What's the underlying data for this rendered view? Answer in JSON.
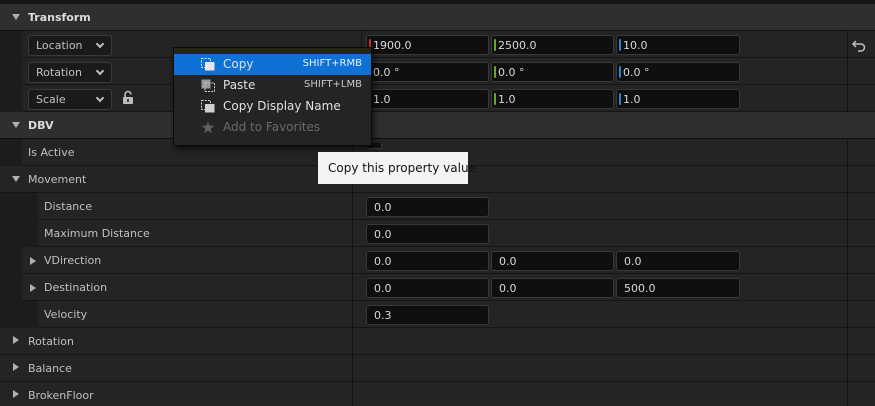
{
  "transform": {
    "title": "Transform",
    "rows": [
      {
        "mode": "Location",
        "values": [
          "1900.0",
          "2500.0",
          "10.0"
        ]
      },
      {
        "mode": "Rotation",
        "values": [
          "0.0 °",
          "0.0 °",
          "0.0 °"
        ]
      },
      {
        "mode": "Scale",
        "values": [
          "1.0",
          "1.0",
          "1.0"
        ]
      }
    ]
  },
  "dbv": {
    "title": "DBV",
    "is_active_label": "Is Active",
    "movement": {
      "title": "Movement",
      "distance": {
        "label": "Distance",
        "value": "0.0"
      },
      "max_distance": {
        "label": "Maximum Distance",
        "value": "0.0"
      },
      "vdirection": {
        "label": "VDirection",
        "values": [
          "0.0",
          "0.0",
          "0.0"
        ]
      },
      "destination": {
        "label": "Destination",
        "values": [
          "0.0",
          "0.0",
          "500.0"
        ]
      },
      "velocity": {
        "label": "Velocity",
        "value": "0.3"
      }
    },
    "collapsed": [
      "Rotation",
      "Balance",
      "BrokenFloor"
    ]
  },
  "context_menu": {
    "items": [
      {
        "label": "Copy",
        "shortcut": "SHIFT+RMB",
        "icon": "copy-icon"
      },
      {
        "label": "Paste",
        "shortcut": "SHIFT+LMB",
        "icon": "paste-icon"
      },
      {
        "label": "Copy Display Name",
        "shortcut": "",
        "icon": "copy-icon"
      },
      {
        "label": "Add to Favorites",
        "shortcut": "",
        "icon": "star-icon"
      }
    ]
  },
  "tooltip": "Copy this property value",
  "colors": {
    "axis_x": "#c42b2b",
    "axis_y": "#6aaa2a",
    "axis_z": "#2f7fd6",
    "highlight": "#0e71d6"
  }
}
